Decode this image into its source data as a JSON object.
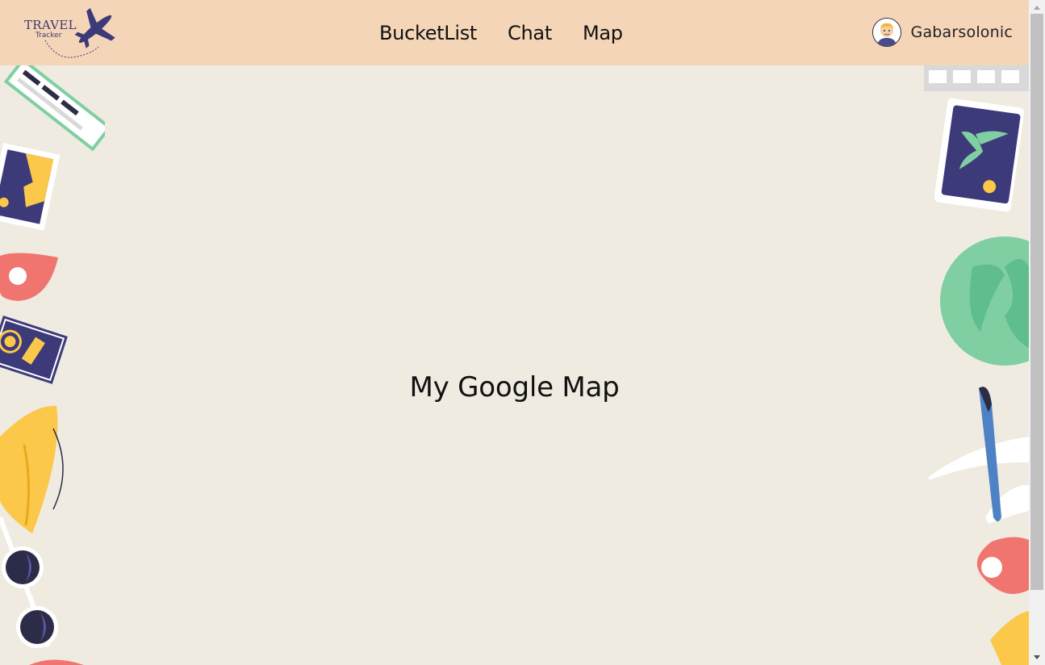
{
  "logo": {
    "line1": "TRAVEL",
    "line2": "Tracker",
    "icon": "airplane-icon"
  },
  "nav": [
    {
      "label": "BucketList"
    },
    {
      "label": "Chat"
    },
    {
      "label": "Map"
    }
  ],
  "user": {
    "name": "Gabarsolonic",
    "avatar_icon": "user-avatar-icon"
  },
  "main": {
    "title": "My Google Map"
  },
  "colors": {
    "navbar": "#f5d5b8",
    "page_bg": "#efebe1",
    "navy": "#3d3a7a",
    "green": "#7fcfa3",
    "coral": "#f0756f",
    "yellow": "#fbc84a"
  }
}
